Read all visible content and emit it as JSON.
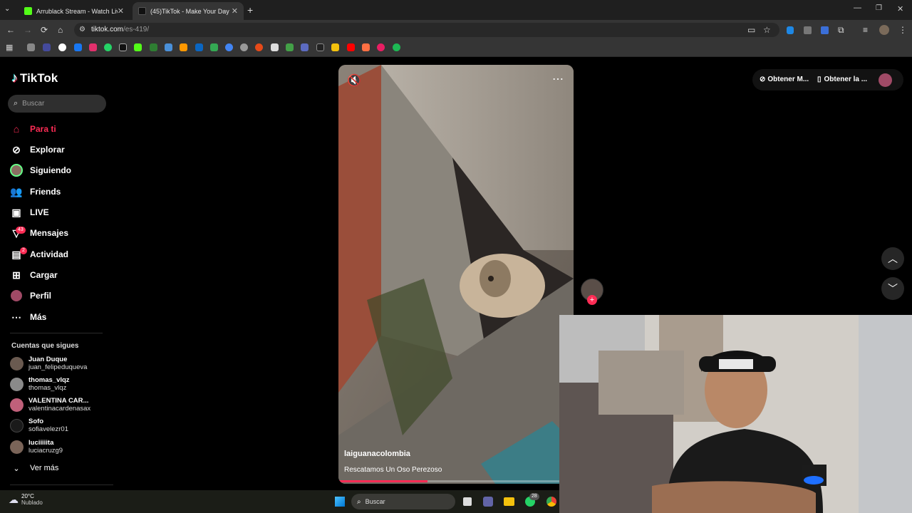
{
  "browser": {
    "tabs": [
      {
        "title": "Arrublack Stream - Watch Live",
        "favicon_color": "#53fc18",
        "active": false
      },
      {
        "title": "(45)TikTok - Make Your Day",
        "favicon_color": "#000000",
        "active": true
      }
    ],
    "url_host": "tiktok.com",
    "url_path": "/es-419/"
  },
  "tiktok": {
    "logo": "TikTok",
    "search_placeholder": "Buscar",
    "nav": [
      {
        "label": "Para ti",
        "icon": "home-icon",
        "active": true
      },
      {
        "label": "Explorar",
        "icon": "compass-icon"
      },
      {
        "label": "Siguiendo",
        "icon": "following-avatar-icon"
      },
      {
        "label": "Friends",
        "icon": "friends-icon"
      },
      {
        "label": "LIVE",
        "icon": "live-icon"
      },
      {
        "label": "Mensajes",
        "icon": "messages-icon",
        "badge": "43"
      },
      {
        "label": "Actividad",
        "icon": "activity-icon",
        "badge": "2"
      },
      {
        "label": "Cargar",
        "icon": "upload-icon"
      },
      {
        "label": "Perfil",
        "icon": "profile-avatar-icon"
      },
      {
        "label": "Más",
        "icon": "more-icon"
      }
    ],
    "following_title": "Cuentas que sigues",
    "following": [
      {
        "name": "Juan Duque",
        "handle": "juan_felipeduqueva"
      },
      {
        "name": "thomas_vlqz",
        "handle": "thomas_vlqz"
      },
      {
        "name": "VALENTINA CAR...",
        "handle": "valentinacardenasax"
      },
      {
        "name": "Sofo",
        "handle": "sofiavelezr01"
      },
      {
        "name": "luciiiiita",
        "handle": "luciacruzg9"
      }
    ],
    "see_more": "Ver más",
    "video": {
      "author": "laiguanacolombia",
      "caption": "Rescatamos Un Oso Perezoso",
      "progress": 0.38
    },
    "top_right": {
      "coins_label": "Obtener M...",
      "app_label": "Obtener la ..."
    }
  },
  "taskbar": {
    "weather_temp": "20°C",
    "weather_desc": "Nublado",
    "search_label": "Buscar",
    "badge": "28"
  }
}
